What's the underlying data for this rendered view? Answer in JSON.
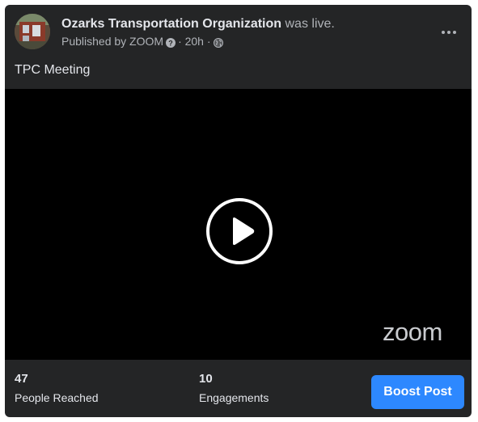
{
  "post": {
    "page_name": "Ozarks Transportation Organization",
    "status_text": " was live.",
    "published_by": "Published by ZOOM",
    "time": " · 20h · ",
    "text": "TPC Meeting"
  },
  "video": {
    "watermark": "zoom",
    "play_icon": "play-icon"
  },
  "stats": {
    "reached_value": "47",
    "reached_label": "People Reached",
    "engagements_value": "10",
    "engagements_label": "Engagements"
  },
  "actions": {
    "boost_label": "Boost Post",
    "more_icon": "more-options-icon"
  },
  "colors": {
    "card_bg": "#242526",
    "primary_text": "#e4e6eb",
    "secondary_text": "#b0b3b8",
    "boost_blue": "#2d88ff",
    "video_bg": "#000000"
  }
}
